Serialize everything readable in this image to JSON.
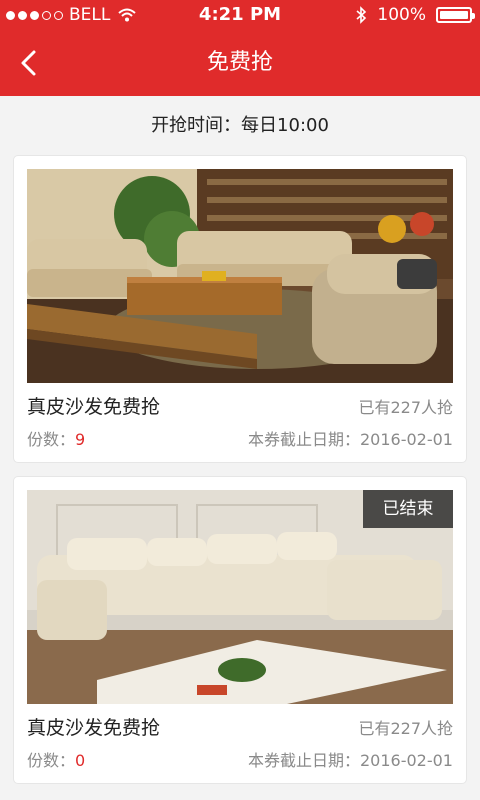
{
  "status_bar": {
    "carrier": "BELL",
    "time": "4:21 PM",
    "battery": "100%",
    "signal_dots_filled": 3,
    "signal_dots_total": 5
  },
  "navbar": {
    "title": "免费抢",
    "back_icon": "chevron-left-icon"
  },
  "open_time": "开抢时间：每日10:00",
  "colors": {
    "brand_red": "#e02b2b",
    "quantity_red": "#e02b2b"
  },
  "items": [
    {
      "title": "真皮沙发免费抢",
      "participants": "已有227人抢",
      "quantity_label": "份数：",
      "quantity_value": "9",
      "expire": "本券截止日期：2016-02-01",
      "badge": ""
    },
    {
      "title": "真皮沙发免费抢",
      "participants": "已有227人抢",
      "quantity_label": "份数：",
      "quantity_value": "0",
      "expire": "本券截止日期：2016-02-01",
      "badge": "已结束"
    }
  ]
}
